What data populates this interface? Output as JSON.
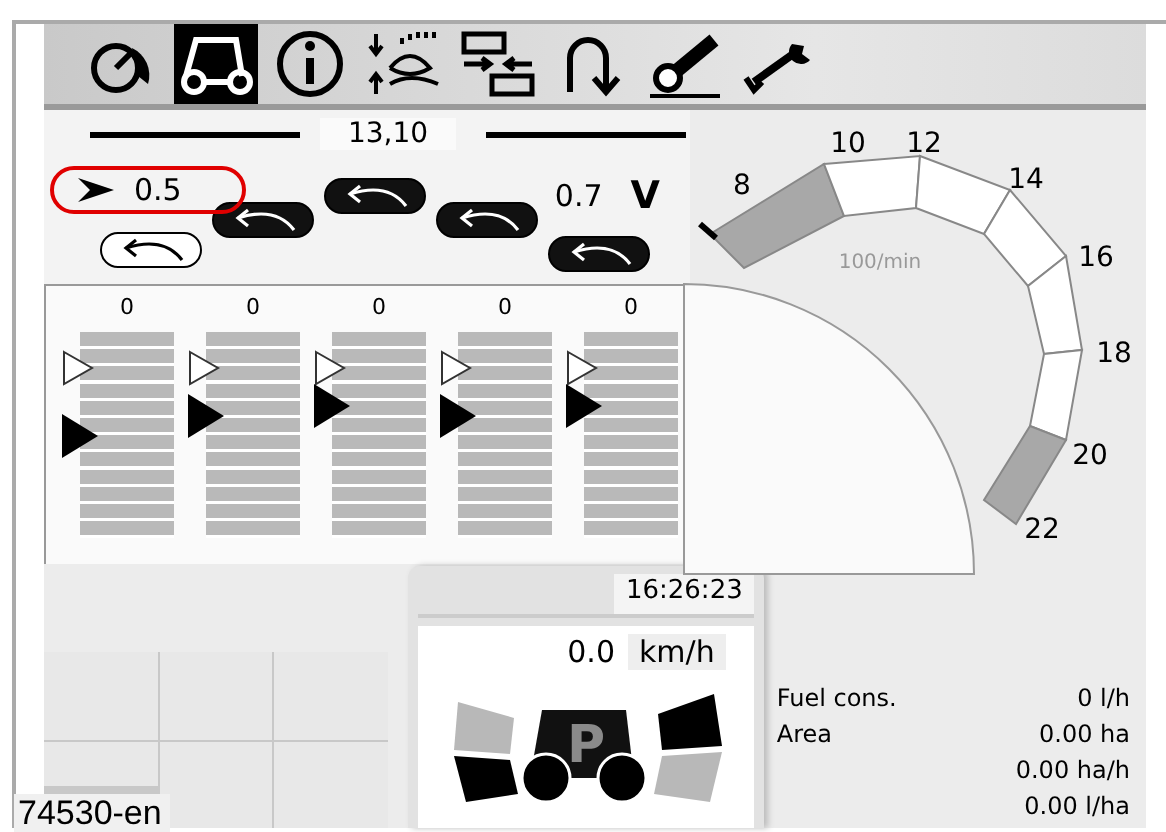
{
  "toolbar": [
    {
      "kind": "gauge",
      "selected": false
    },
    {
      "kind": "tractor",
      "selected": true
    },
    {
      "kind": "info",
      "selected": false
    },
    {
      "kind": "hitch",
      "selected": false
    },
    {
      "kind": "layout",
      "selected": false
    },
    {
      "kind": "turn",
      "selected": false
    },
    {
      "kind": "pto",
      "selected": false
    },
    {
      "kind": "wrench",
      "selected": false
    }
  ],
  "header_value": "13,10",
  "left_reading": {
    "value": "0.5",
    "highlighted": true
  },
  "right_reading": {
    "value": "0.7",
    "label": "V"
  },
  "valves": [
    {
      "active": false,
      "value": "0",
      "level": 0.5,
      "limit_marker": {
        "level": 0.83
      }
    },
    {
      "active": true,
      "value": "0",
      "level": 0.59,
      "limit_marker": {
        "level": 0.83
      }
    },
    {
      "active": true,
      "value": "0",
      "level": 0.64,
      "limit_marker": {
        "level": 0.83
      }
    },
    {
      "active": true,
      "value": "0",
      "level": 0.59,
      "limit_marker": {
        "level": 0.83
      }
    },
    {
      "active": true,
      "value": "0",
      "level": 0.64,
      "limit_marker": {
        "level": 0.83
      }
    }
  ],
  "gauge": {
    "unit": "100/min",
    "scale": [
      "8",
      "10",
      "12",
      "14",
      "16",
      "18",
      "20",
      "22"
    ]
  },
  "drive": {
    "time": "16:26:23",
    "speed": "0.0",
    "speed_unit": "km/h",
    "gear": "P"
  },
  "stats": [
    {
      "label": "Fuel cons.",
      "value": "0 l/h"
    },
    {
      "label": "Area",
      "value": "0.00 ha"
    },
    {
      "value": "0.00 ha/h"
    },
    {
      "value": "0.00 l/ha"
    }
  ],
  "figure_id": "74530-en"
}
